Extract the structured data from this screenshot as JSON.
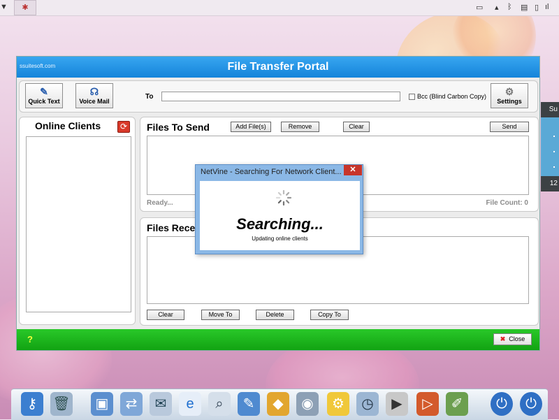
{
  "window": {
    "brand": "ssuitesoft.com",
    "title": "File Transfer Portal"
  },
  "toolbar": {
    "quick_text_label": "Quick Text",
    "voice_mail_label": "Voice Mail",
    "to_label": "To",
    "to_value": "",
    "bcc_label": "Bcc (Blind Carbon Copy)",
    "bcc_checked": false,
    "settings_label": "Settings"
  },
  "clients": {
    "header": "Online Clients"
  },
  "send": {
    "header": "Files To Send",
    "add_label": "Add File(s)",
    "remove_label": "Remove",
    "clear_label": "Clear",
    "send_label": "Send",
    "status": "Ready...",
    "file_count": "File Count: 0"
  },
  "receive": {
    "header": "Files Rece",
    "clear_label": "Clear",
    "move_label": "Move To",
    "delete_label": "Delete",
    "copy_label": "Copy To"
  },
  "footer": {
    "help_label": "?",
    "close_label": "Close"
  },
  "dialog": {
    "title": "NetVine - Searching For Network Client...",
    "close_glyph": "✕",
    "heading": "Searching...",
    "message": "Updating online clients"
  },
  "side_widget": {
    "top_text": "Su",
    "bottom_text": "12"
  },
  "dock": {
    "icons": [
      "key-icon",
      "trash-icon",
      "computer-icon",
      "network-icon",
      "mail-icon",
      "browser-icon",
      "search-icon",
      "tools-icon",
      "windows-icon",
      "disk-icon",
      "gear-icon",
      "folder-clock-icon",
      "media-icon",
      "video-icon",
      "paint-icon",
      "power-icon",
      "shutdown-icon"
    ]
  },
  "colors": {
    "title_blue": "#1484da",
    "footer_green": "#12a312",
    "dialog_frame": "#8bb8e6"
  }
}
